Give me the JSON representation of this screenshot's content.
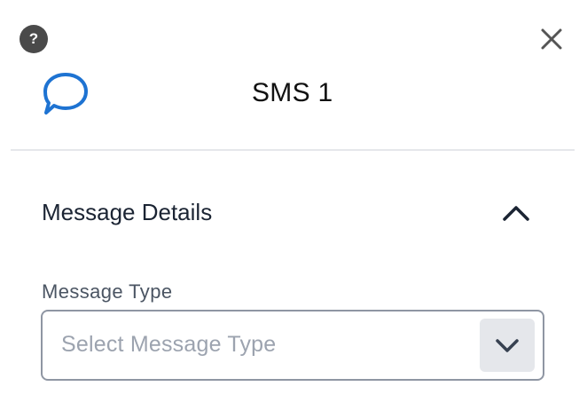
{
  "header": {
    "title": "SMS 1",
    "help_label": "?",
    "icons": {
      "help": "help-icon",
      "close": "close-icon",
      "channel": "chat-bubble-icon"
    },
    "accent_color": "#1e73d2"
  },
  "section": {
    "title": "Message Details",
    "expanded": true,
    "toggle_icon": "chevron-up-icon"
  },
  "message_type": {
    "label": "Message Type",
    "placeholder": "Select Message Type",
    "value": "",
    "dropdown_icon": "chevron-down-icon"
  }
}
